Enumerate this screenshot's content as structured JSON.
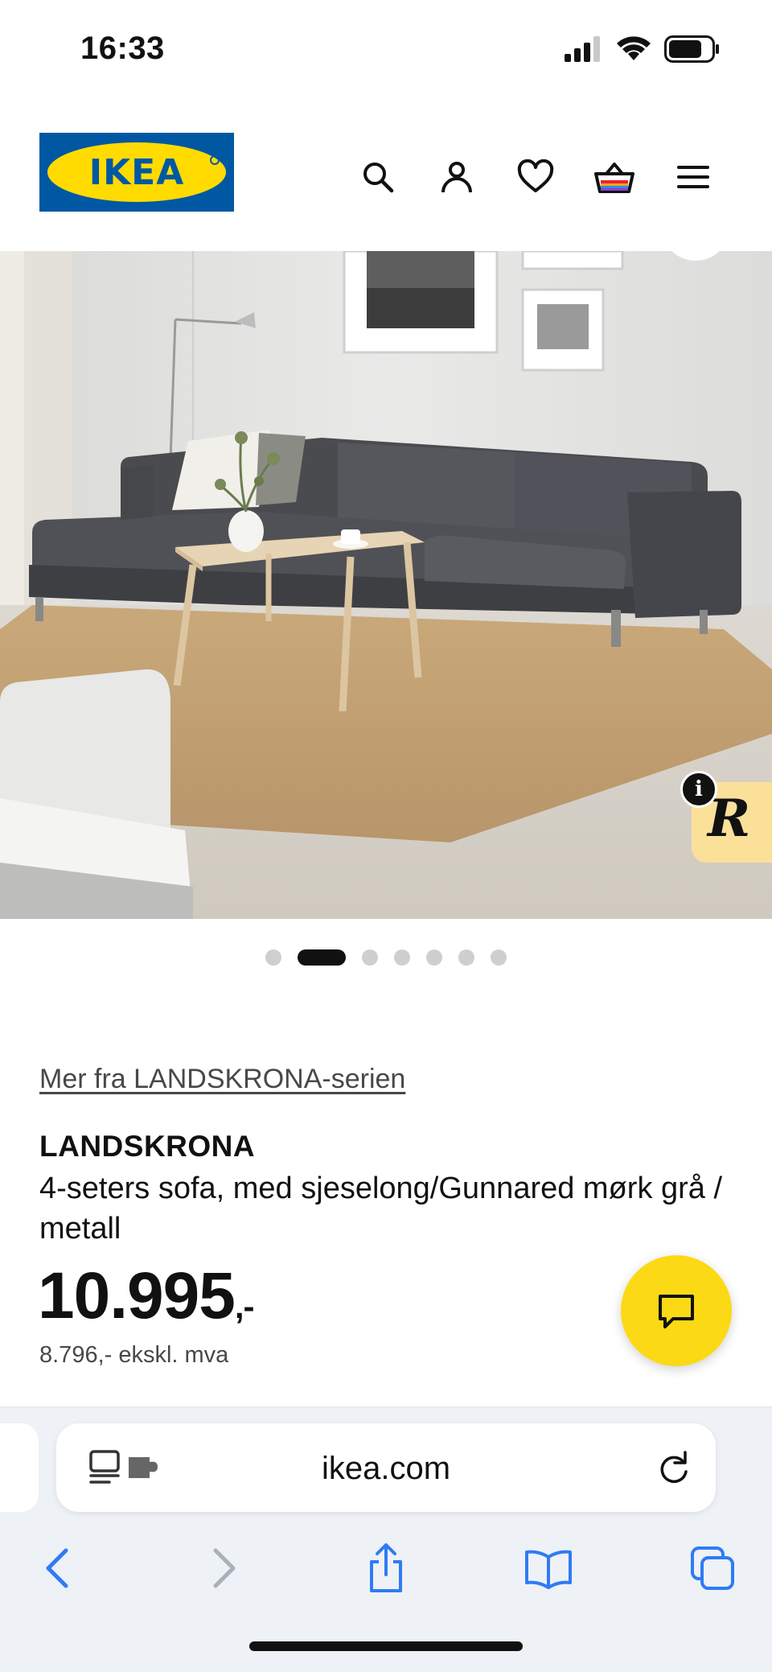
{
  "status_bar": {
    "time": "16:33"
  },
  "header": {
    "logo_text": "IKEA",
    "icons": [
      "search-icon",
      "user-icon",
      "heart-icon",
      "basket-icon",
      "menu-icon"
    ]
  },
  "carousel": {
    "total": 7,
    "active_index": 1
  },
  "product": {
    "series_link": "Mer fra LANDSKRONA-serien",
    "name": "LANDSKRONA",
    "description": "4-seters sofa, med sjeselong/Gunnared mørk grå / metall",
    "price": "10.995",
    "price_suffix": ",-",
    "price_excl_vat": "8.796,- ekskl. mva"
  },
  "badge": {
    "letter": "R",
    "info": "i"
  },
  "browser": {
    "url": "ikea.com",
    "nav_icons": [
      "back-icon",
      "forward-icon",
      "share-icon",
      "bookmarks-icon",
      "tabs-icon"
    ]
  },
  "colors": {
    "brand_blue": "#0058a3",
    "brand_yellow": "#ffdb00",
    "chat_yellow": "#fbd914",
    "safari_blue": "#2f7bf5"
  }
}
